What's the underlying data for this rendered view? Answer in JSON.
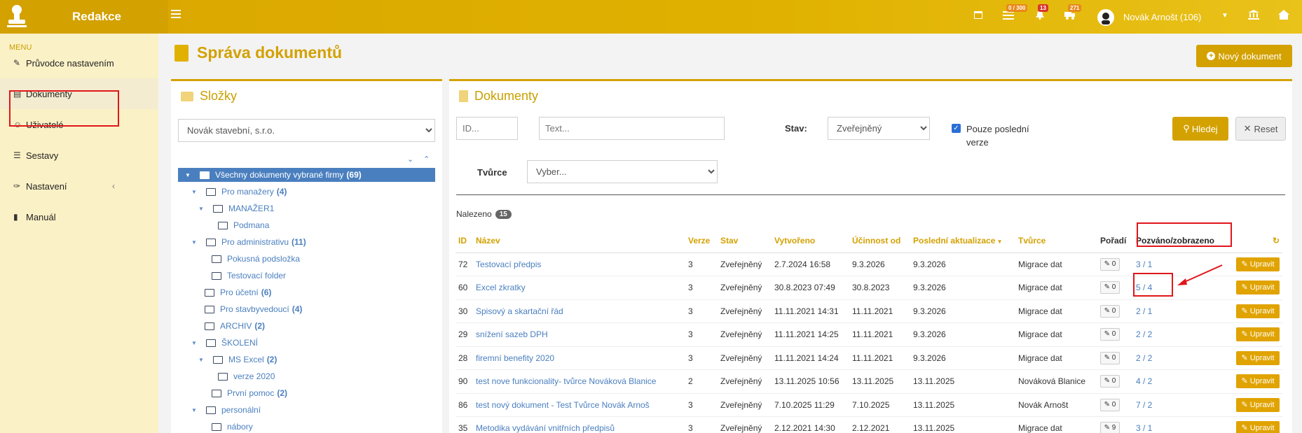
{
  "app": {
    "title": "Redakce"
  },
  "topbar": {
    "icons": [
      {
        "name": "calendar-icon",
        "badge": ""
      },
      {
        "name": "tasks-icon",
        "badge": "0 / 300"
      },
      {
        "name": "bell-icon",
        "badge": "13"
      },
      {
        "name": "truck-icon",
        "badge": "271"
      }
    ],
    "user_name": "Novák Arnošt (106)"
  },
  "sidebar": {
    "menu_label": "MENU",
    "items": [
      {
        "label": "Průvodce nastavením",
        "icon": "pencil-icon"
      },
      {
        "label": "Dokumenty",
        "icon": "document-icon"
      },
      {
        "label": "Uživatelé",
        "icon": "users-icon"
      },
      {
        "label": "Sestavy",
        "icon": "list-icon"
      },
      {
        "label": "Nastavení",
        "icon": "wrench-icon"
      },
      {
        "label": "Manuál",
        "icon": "book-icon"
      }
    ]
  },
  "page": {
    "title": "Správa dokumentů",
    "new_button": "Nový dokument"
  },
  "folders": {
    "title": "Složky",
    "company_select": "Novák stavební, s.r.o.",
    "tree": [
      {
        "label": "Všechny dokumenty vybrané firmy",
        "count": "(69)"
      },
      {
        "label": "Pro manažery",
        "count": "(4)"
      },
      {
        "label": "MANAŽER1",
        "count": ""
      },
      {
        "label": "Podmana",
        "count": ""
      },
      {
        "label": "Pro administrativu",
        "count": "(11)"
      },
      {
        "label": "Pokusná podsložka",
        "count": ""
      },
      {
        "label": "Testovací folder",
        "count": ""
      },
      {
        "label": "Pro účetní",
        "count": "(6)"
      },
      {
        "label": "Pro stavbyvedoucí",
        "count": "(4)"
      },
      {
        "label": "ARCHIV",
        "count": "(2)"
      },
      {
        "label": "ŠKOLENÍ",
        "count": ""
      },
      {
        "label": "MS Excel",
        "count": "(2)"
      },
      {
        "label": "verze 2020",
        "count": ""
      },
      {
        "label": "První pomoc",
        "count": "(2)"
      },
      {
        "label": "personální",
        "count": ""
      },
      {
        "label": "nábory",
        "count": ""
      }
    ]
  },
  "documents": {
    "title": "Dokumenty",
    "filters": {
      "id_placeholder": "ID...",
      "text_placeholder": "Text...",
      "stav_label": "Stav:",
      "stav_value": "Zveřejněný",
      "only_latest_label_1": "Pouze poslední",
      "only_latest_label_2": "verze",
      "search_button": "Hledej",
      "reset_button": "Reset",
      "creator_label": "Tvůrce",
      "creator_value": "Vyber..."
    },
    "found_label": "Nalezeno",
    "found_count": "15",
    "columns": [
      "ID",
      "Název",
      "Verze",
      "Stav",
      "Vytvořeno",
      "Účinnost od",
      "Poslední aktualizace",
      "Tvůrce",
      "Pořadí",
      "Pozváno/zobrazeno"
    ],
    "edit_label": "Upravit",
    "rows": [
      {
        "id": "72",
        "name": "Testovací předpis",
        "version": "3",
        "state": "Zveřejněný",
        "created": "2.7.2024 16:58",
        "effective": "9.3.2026",
        "updated": "9.3.2026",
        "creator": "Migrace dat",
        "order": "0",
        "invited": "3 / 1"
      },
      {
        "id": "60",
        "name": "Excel zkratky",
        "version": "3",
        "state": "Zveřejněný",
        "created": "30.8.2023 07:49",
        "effective": "30.8.2023",
        "updated": "9.3.2026",
        "creator": "Migrace dat",
        "order": "0",
        "invited": "5 / 4"
      },
      {
        "id": "30",
        "name": "Spisový a skartační řád",
        "version": "3",
        "state": "Zveřejněný",
        "created": "11.11.2021 14:31",
        "effective": "11.11.2021",
        "updated": "9.3.2026",
        "creator": "Migrace dat",
        "order": "0",
        "invited": "2 / 1"
      },
      {
        "id": "29",
        "name": "snížení sazeb DPH",
        "version": "3",
        "state": "Zveřejněný",
        "created": "11.11.2021 14:25",
        "effective": "11.11.2021",
        "updated": "9.3.2026",
        "creator": "Migrace dat",
        "order": "0",
        "invited": "2 / 2"
      },
      {
        "id": "28",
        "name": "firemní benefity 2020",
        "version": "3",
        "state": "Zveřejněný",
        "created": "11.11.2021 14:24",
        "effective": "11.11.2021",
        "updated": "9.3.2026",
        "creator": "Migrace dat",
        "order": "0",
        "invited": "2 / 2"
      },
      {
        "id": "90",
        "name": "test nove funkcionality- tvůrce Nováková Blanice",
        "version": "2",
        "state": "Zveřejněný",
        "created": "13.11.2025 10:56",
        "effective": "13.11.2025",
        "updated": "13.11.2025",
        "creator": "Nováková Blanice",
        "order": "0",
        "invited": "4 / 2"
      },
      {
        "id": "86",
        "name": "test nový dokument - Test Tvůrce Novák Arnoš",
        "version": "3",
        "state": "Zveřejněný",
        "created": "7.10.2025 11:29",
        "effective": "7.10.2025",
        "updated": "13.11.2025",
        "creator": "Novák Arnošt",
        "order": "0",
        "invited": "7 / 2"
      },
      {
        "id": "35",
        "name": "Metodika vydávání vnitřních předpisů",
        "version": "3",
        "state": "Zveřejněný",
        "created": "2.12.2021 14:30",
        "effective": "2.12.2021",
        "updated": "13.11.2025",
        "creator": "Migrace dat",
        "order": "9",
        "invited": "3 / 1"
      }
    ]
  }
}
